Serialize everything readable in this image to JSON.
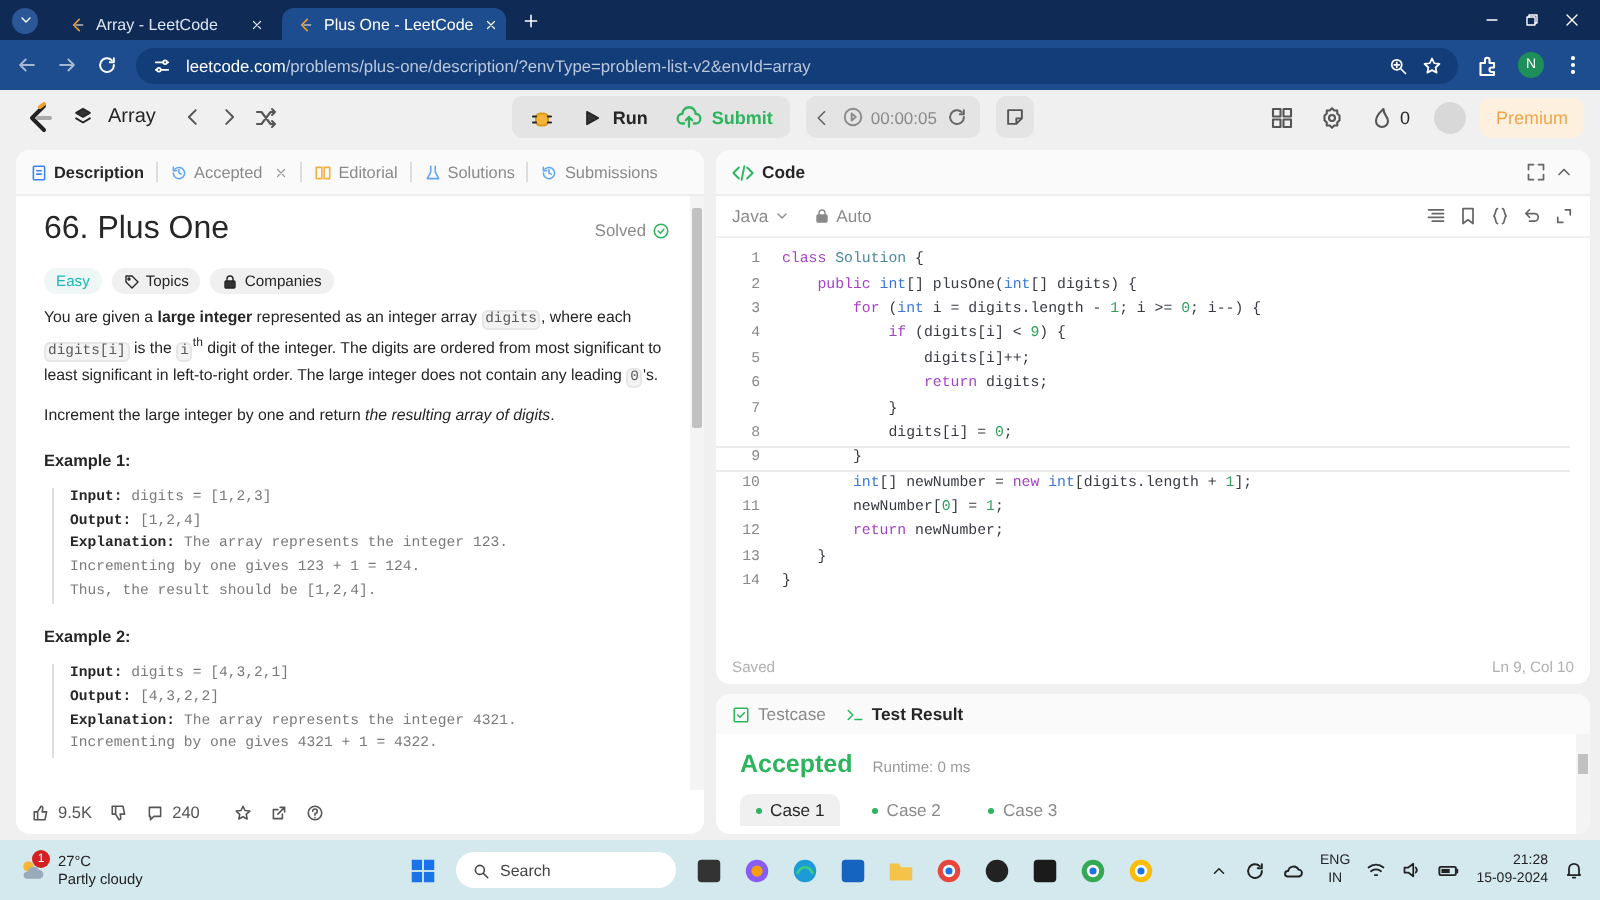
{
  "browser": {
    "tabs": [
      {
        "title": "Array - LeetCode",
        "selected": false
      },
      {
        "title": "Plus One - LeetCode",
        "selected": true
      }
    ],
    "url_host": "leetcode.com",
    "url_path": "/problems/plus-one/description/?envType=problem-list-v2&envId=array",
    "profile_initial": "N"
  },
  "toolbar": {
    "list_name": "Array",
    "run": "Run",
    "submit": "Submit",
    "timer": "00:00:05",
    "streak": "0",
    "premium": "Premium"
  },
  "description": {
    "tabs": [
      {
        "label": "Description",
        "selected": true,
        "closable": false
      },
      {
        "label": "Accepted",
        "selected": false,
        "closable": true
      },
      {
        "label": "Editorial",
        "selected": false,
        "closable": false
      },
      {
        "label": "Solutions",
        "selected": false,
        "closable": false
      },
      {
        "label": "Submissions",
        "selected": false,
        "closable": false
      }
    ],
    "title": "66. Plus One",
    "status": "Solved",
    "tags": [
      {
        "label": "Easy",
        "kind": "difficulty"
      },
      {
        "label": "Topics",
        "kind": "topics"
      },
      {
        "label": "Companies",
        "kind": "companies"
      }
    ],
    "paragraphs": [
      [
        {
          "text": "You are given a ",
          "kind": "plain"
        },
        {
          "text": "large integer",
          "kind": "bold"
        },
        {
          "text": " represented as an integer array ",
          "kind": "plain"
        },
        {
          "text": "digits",
          "kind": "code"
        },
        {
          "text": ", where each ",
          "kind": "plain"
        },
        {
          "text": "digits[i]",
          "kind": "code"
        },
        {
          "text": " is the ",
          "kind": "plain"
        },
        {
          "text": "i",
          "kind": "code"
        },
        {
          "text": "th",
          "kind": "sup"
        },
        {
          "text": " digit of the integer. The digits are ordered from most significant to least significant in left-to-right order. The large integer does not contain any leading ",
          "kind": "plain"
        },
        {
          "text": "0",
          "kind": "code"
        },
        {
          "text": "'s.",
          "kind": "plain"
        }
      ],
      [
        {
          "text": "Increment the large integer by one and return ",
          "kind": "plain"
        },
        {
          "text": "the resulting array of digits",
          "kind": "italic"
        },
        {
          "text": ".",
          "kind": "plain"
        }
      ]
    ],
    "examples": [
      {
        "title": "Example 1:",
        "lines": [
          {
            "label": "Input:",
            "value": "digits = [1,2,3]"
          },
          {
            "label": "Output:",
            "value": "[1,2,4]"
          },
          {
            "label": "Explanation:",
            "value": "The array represents the integer 123."
          },
          {
            "value": "Incrementing by one gives 123 + 1 = 124."
          },
          {
            "value": "Thus, the result should be [1,2,4]."
          }
        ]
      },
      {
        "title": "Example 2:",
        "lines": [
          {
            "label": "Input:",
            "value": "digits = [4,3,2,1]"
          },
          {
            "label": "Output:",
            "value": "[4,3,2,2]"
          },
          {
            "label": "Explanation:",
            "value": "The array represents the integer 4321."
          },
          {
            "value": "Incrementing by one gives 4321 + 1 = 4322."
          }
        ]
      }
    ],
    "likes": "9.5K",
    "comments": "240"
  },
  "editor": {
    "title": "Code",
    "language": "Java",
    "mode": "Auto",
    "save_status": "Saved",
    "cursor": "Ln 9, Col 10",
    "lines": [
      {
        "number": "1",
        "current": false,
        "tokens": [
          {
            "text": "class",
            "kind": "kw"
          },
          {
            "text": " Solution",
            "kind": "cls"
          },
          {
            "text": " {",
            "kind": "plain"
          }
        ]
      },
      {
        "number": "2",
        "current": false,
        "tokens": [
          {
            "text": "    public",
            "kind": "kw"
          },
          {
            "text": " int",
            "kind": "type"
          },
          {
            "text": "[] plusOne(",
            "kind": "plain"
          },
          {
            "text": "int",
            "kind": "type"
          },
          {
            "text": "[] digits) {",
            "kind": "plain"
          }
        ]
      },
      {
        "number": "3",
        "current": false,
        "tokens": [
          {
            "text": "        for",
            "kind": "kw"
          },
          {
            "text": " (",
            "kind": "plain"
          },
          {
            "text": "int",
            "kind": "type"
          },
          {
            "text": " i = digits.length - ",
            "kind": "plain"
          },
          {
            "text": "1",
            "kind": "num"
          },
          {
            "text": "; i >= ",
            "kind": "plain"
          },
          {
            "text": "0",
            "kind": "num"
          },
          {
            "text": "; i--) {",
            "kind": "plain"
          }
        ]
      },
      {
        "number": "4",
        "current": false,
        "tokens": [
          {
            "text": "            if",
            "kind": "kw"
          },
          {
            "text": " (digits[i] < ",
            "kind": "plain"
          },
          {
            "text": "9",
            "kind": "num"
          },
          {
            "text": ") {",
            "kind": "plain"
          }
        ]
      },
      {
        "number": "5",
        "current": false,
        "tokens": [
          {
            "text": "                digits[i]++;",
            "kind": "plain"
          }
        ]
      },
      {
        "number": "6",
        "current": false,
        "tokens": [
          {
            "text": "                return",
            "kind": "kw"
          },
          {
            "text": " digits;",
            "kind": "plain"
          }
        ]
      },
      {
        "number": "7",
        "current": false,
        "tokens": [
          {
            "text": "            }",
            "kind": "plain"
          }
        ]
      },
      {
        "number": "8",
        "current": false,
        "tokens": [
          {
            "text": "            digits[i] = ",
            "kind": "plain"
          },
          {
            "text": "0",
            "kind": "num"
          },
          {
            "text": ";",
            "kind": "plain"
          }
        ]
      },
      {
        "number": "9",
        "current": true,
        "tokens": [
          {
            "text": "        }",
            "kind": "plain"
          }
        ]
      },
      {
        "number": "10",
        "current": false,
        "tokens": [
          {
            "text": "        int",
            "kind": "type"
          },
          {
            "text": "[] newNumber = ",
            "kind": "plain"
          },
          {
            "text": "new",
            "kind": "kw"
          },
          {
            "text": " int",
            "kind": "type"
          },
          {
            "text": "[digits.length + ",
            "kind": "plain"
          },
          {
            "text": "1",
            "kind": "num"
          },
          {
            "text": "];",
            "kind": "plain"
          }
        ]
      },
      {
        "number": "11",
        "current": false,
        "tokens": [
          {
            "text": "        newNumber[",
            "kind": "plain"
          },
          {
            "text": "0",
            "kind": "num"
          },
          {
            "text": "] = ",
            "kind": "plain"
          },
          {
            "text": "1",
            "kind": "num"
          },
          {
            "text": ";",
            "kind": "plain"
          }
        ]
      },
      {
        "number": "12",
        "current": false,
        "tokens": [
          {
            "text": "        return",
            "kind": "kw"
          },
          {
            "text": " newNumber;",
            "kind": "plain"
          }
        ]
      },
      {
        "number": "13",
        "current": false,
        "tokens": [
          {
            "text": "    }",
            "kind": "plain"
          }
        ]
      },
      {
        "number": "14",
        "current": false,
        "tokens": [
          {
            "text": "}",
            "kind": "plain"
          }
        ]
      }
    ]
  },
  "result": {
    "tabs": [
      {
        "label": "Testcase",
        "selected": false
      },
      {
        "label": "Test Result",
        "selected": true
      }
    ],
    "verdict": "Accepted",
    "runtime": "Runtime: 0 ms",
    "cases": [
      {
        "label": "Case 1",
        "selected": true
      },
      {
        "label": "Case 2",
        "selected": false
      },
      {
        "label": "Case 3",
        "selected": false
      }
    ]
  },
  "taskbar": {
    "temperature": "27°C",
    "weather": "Partly cloudy",
    "weather_badge": "1",
    "search_placeholder": "Search",
    "language": "ENG",
    "region": "IN",
    "time": "21:28",
    "date": "15-09-2024"
  }
}
